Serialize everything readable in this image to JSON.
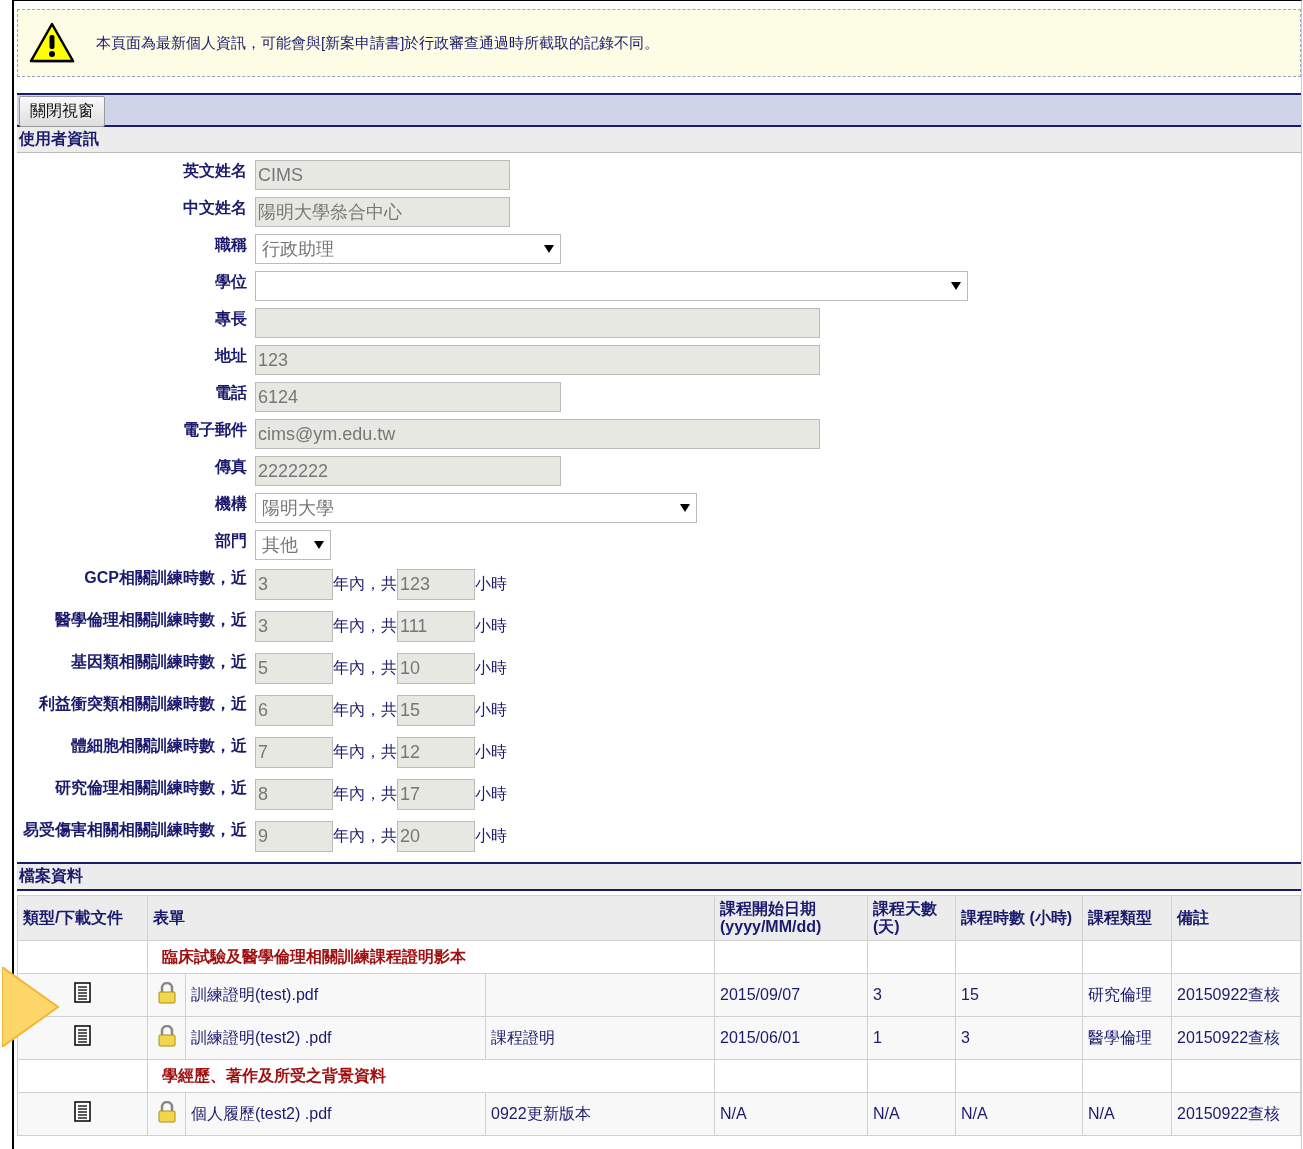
{
  "notice": {
    "text": "本頁面為最新個人資訊，可能會與[新案申請書]於行政審查通過時所截取的記錄不同。"
  },
  "toolbar": {
    "close_button": "關閉視窗"
  },
  "user_info": {
    "title": "使用者資訊",
    "fields": [
      {
        "label": "英文姓名",
        "kind": "text",
        "value": "CIMS"
      },
      {
        "label": "中文姓名",
        "kind": "text",
        "value": "陽明大學叅合中心"
      },
      {
        "label": "職稱",
        "kind": "select",
        "value": "行政助理"
      },
      {
        "label": "學位",
        "kind": "select"
      },
      {
        "label": "專長",
        "kind": "text"
      },
      {
        "label": "地址",
        "kind": "text",
        "value": "123"
      },
      {
        "label": "電話",
        "kind": "text",
        "value": "6124"
      },
      {
        "label": "電子郵件",
        "kind": "text",
        "value": "cims@ym.edu.tw"
      },
      {
        "label": "傳真",
        "kind": "text",
        "value": "2222222"
      },
      {
        "label": "機構",
        "kind": "select",
        "value": "陽明大學"
      },
      {
        "label": "部門",
        "kind": "select",
        "value": "其他"
      }
    ],
    "training": [
      {
        "label": "GCP相關訓練時數，近",
        "years": "3",
        "mid": "年內，共",
        "hours": "123",
        "unit": "小時"
      },
      {
        "label": "醫學倫理相關訓練時數，近",
        "years": "3",
        "mid": "年內，共",
        "hours": "111",
        "unit": "小時"
      },
      {
        "label": "基因類相關訓練時數，近",
        "years": "5",
        "mid": "年內，共",
        "hours": "10",
        "unit": "小時"
      },
      {
        "label": "利益衝突類相關訓練時數，近",
        "years": "6",
        "mid": "年內，共",
        "hours": "15",
        "unit": "小時"
      },
      {
        "label": "體細胞相關訓練時數，近",
        "years": "7",
        "mid": "年內，共",
        "hours": "12",
        "unit": "小時"
      },
      {
        "label": "研究倫理相關訓練時數，近",
        "years": "8",
        "mid": "年內，共",
        "hours": "17",
        "unit": "小時"
      },
      {
        "label": "易受傷害相關相關訓練時數，近",
        "years": "9",
        "mid": "年內，共",
        "hours": "20",
        "unit": "小時"
      }
    ]
  },
  "files": {
    "title": "檔案資料",
    "columns": [
      "類型/下載文件",
      "表單",
      "課程開始日期(yyyy/MM/dd)",
      "課程天數(天)",
      "課程時數 (小時)",
      "課程類型",
      "備註"
    ],
    "rows": [
      {
        "kind": "section",
        "title": "臨床試驗及醫學倫理相關訓練課程證明影本"
      },
      {
        "kind": "file",
        "file": "訓練證明(test).pdf",
        "start_date": "2015/09/07",
        "days": "3",
        "hours": "15",
        "course_type": "研究倫理",
        "note": "20150922查核"
      },
      {
        "kind": "file",
        "file": "訓練證明(test2) .pdf",
        "form": "課程證明",
        "start_date": "2015/06/01",
        "days": "1",
        "hours": "3",
        "course_type": "醫學倫理",
        "note": "20150922查核"
      },
      {
        "kind": "section",
        "title": "學經歷、著作及所受之背景資料"
      },
      {
        "kind": "file",
        "file": "個人履歷(test2) .pdf",
        "form": "0922更新版本",
        "start_date": "N/A",
        "days": "N/A",
        "hours": "N/A",
        "course_type": "N/A",
        "note": "20150922查核"
      }
    ]
  }
}
